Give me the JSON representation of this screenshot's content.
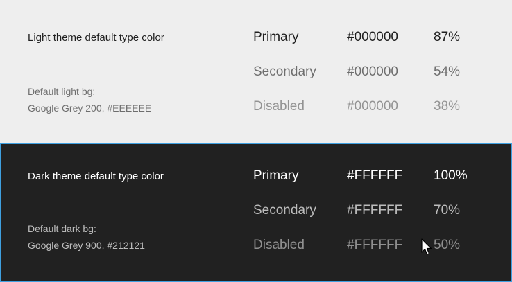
{
  "light": {
    "title": "Light theme default type color",
    "bg_line1": "Default light bg:",
    "bg_line2": "Google Grey 200, #EEEEEE",
    "background_color": "#EEEEEE",
    "rows": [
      {
        "label": "Primary",
        "hex": "#000000",
        "opacity": "87%"
      },
      {
        "label": "Secondary",
        "hex": "#000000",
        "opacity": "54%"
      },
      {
        "label": "Disabled",
        "hex": "#000000",
        "opacity": "38%"
      }
    ]
  },
  "dark": {
    "title": "Dark theme default type color",
    "bg_line1": "Default dark bg:",
    "bg_line2": "Google Grey 900, #212121",
    "background_color": "#212121",
    "border_color": "#3FA0E0",
    "rows": [
      {
        "label": "Primary",
        "hex": "#FFFFFF",
        "opacity": "100%"
      },
      {
        "label": "Secondary",
        "hex": "#FFFFFF",
        "opacity": "70%"
      },
      {
        "label": "Disabled",
        "hex": "#FFFFFF",
        "opacity": "50%"
      }
    ]
  },
  "cursor": {
    "icon": "mouse-pointer-icon"
  }
}
